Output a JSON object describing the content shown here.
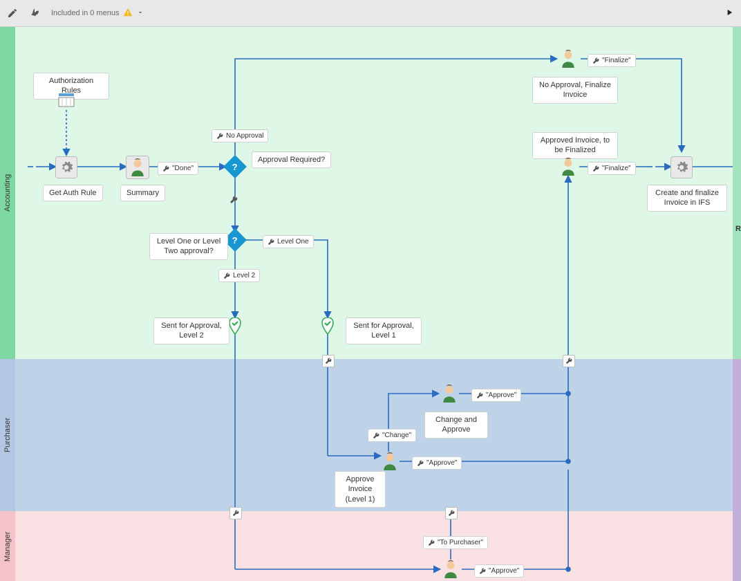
{
  "toolbar": {
    "menu_text": "Included in 0 menus"
  },
  "lanes": {
    "accounting": "Accounting",
    "purchaser": "Purchaser",
    "manager": "Manager"
  },
  "labels": {
    "auth_rules": "Authorization Rules",
    "get_auth_rule": "Get Auth Rule",
    "summary": "Summary",
    "done": "\"Done\"",
    "no_approval": "No Approval",
    "approval_required": "Approval Required?",
    "level_one_or_two": "Level One or Level Two approval?",
    "level_one": "Level One",
    "level_2": "Level 2",
    "sent_l2": "Sent for Approval, Level 2",
    "sent_l1": "Sent for Approval, Level 1",
    "no_approval_finalize": "No Approval, Finalize Invoice",
    "approved_to_finalize": "Approved Invoice, to be Finalized",
    "finalize": "\"Finalize\"",
    "create_finalize": "Create and finalize Invoice in IFS",
    "change": "\"Change\"",
    "approve": "\"Approve\"",
    "change_and_approve": "Change and Approve",
    "approve_l1": "Approve Invoice (Level 1)",
    "to_purchaser": "\"To Purchaser\""
  },
  "edge_r": "R"
}
